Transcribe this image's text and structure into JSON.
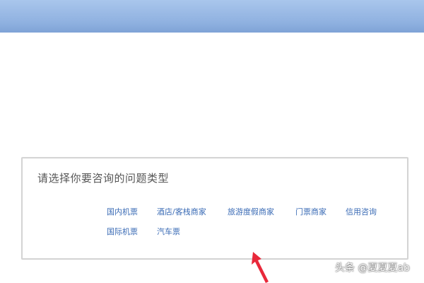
{
  "panel": {
    "title": "请选择你要咨询的问题类型",
    "options_row1": [
      "国内机票",
      "酒店/客栈商家",
      "旅游度假商家",
      "门票商家",
      "信用咨询"
    ],
    "options_row2": [
      "国际机票",
      "汽车票"
    ]
  },
  "watermark": "头条 @夏夏夏ab",
  "colors": {
    "top_bar": "#8fb1e0",
    "link": "#3a6bb5",
    "arrow": "#e8283a"
  }
}
